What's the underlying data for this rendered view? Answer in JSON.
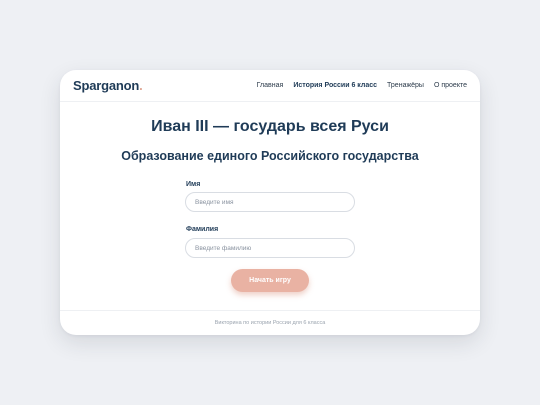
{
  "header": {
    "logo_text": "Sparganon",
    "logo_dot": ".",
    "nav": [
      {
        "label": "Главная"
      },
      {
        "label": "История России 6 класс"
      },
      {
        "label": "Тренажёры"
      },
      {
        "label": "О проекте"
      }
    ]
  },
  "main": {
    "title": "Иван III — государь всея Руси",
    "subtitle": "Образование единого Российского государства",
    "form": {
      "first_name_label": "Имя",
      "first_name_placeholder": "Введите имя",
      "last_name_label": "Фамилия",
      "last_name_placeholder": "Введите фамилию",
      "start_button": "Начать игру"
    }
  },
  "footer": {
    "text": "Викторина по истории России для 6 класса"
  },
  "colors": {
    "brand": "#1f3b57",
    "accent": "#e9b2a3",
    "background": "#eef0f4"
  }
}
